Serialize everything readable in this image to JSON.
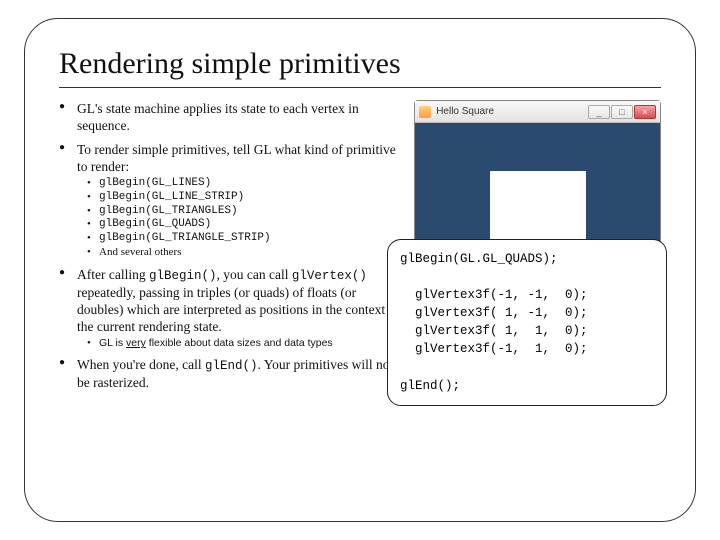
{
  "title": "Rendering simple primitives",
  "bullets": {
    "b1": "GL's state machine applies its state to each vertex in sequence.",
    "b2": "To render simple primitives, tell GL what kind of primitive to render:",
    "b2_items": {
      "i1": "glBegin(GL_LINES)",
      "i2": "glBegin(GL_LINE_STRIP)",
      "i3": "glBegin(GL_TRIANGLES)",
      "i4": "glBegin(GL_QUADS)",
      "i5": "glBegin(GL_TRIANGLE_STRIP)",
      "i6": "And several others"
    },
    "b3_pre": "After calling ",
    "b3_code1": "glBegin()",
    "b3_mid": ", you can call ",
    "b3_code2": "glVertex()",
    "b3_post": " repeatedly, passing in triples (or quads) of floats (or doubles) which are interpreted as positions in the context of the current rendering state.",
    "b3_sub_pre": "GL is ",
    "b3_sub_u": "very",
    "b3_sub_post": " flexible about data sizes and data types",
    "b4_pre": "When you're done, call ",
    "b4_code": "glEnd()",
    "b4_post": ".  Your primitives will now be rasterized."
  },
  "window": {
    "title": "Hello Square",
    "min": "_",
    "max": "□",
    "close": "×"
  },
  "code": "glBegin(GL.GL_QUADS);\n\n  glVertex3f(-1, -1,  0);\n  glVertex3f( 1, -1,  0);\n  glVertex3f( 1,  1,  0);\n  glVertex3f(-1,  1,  0);\n\nglEnd();"
}
